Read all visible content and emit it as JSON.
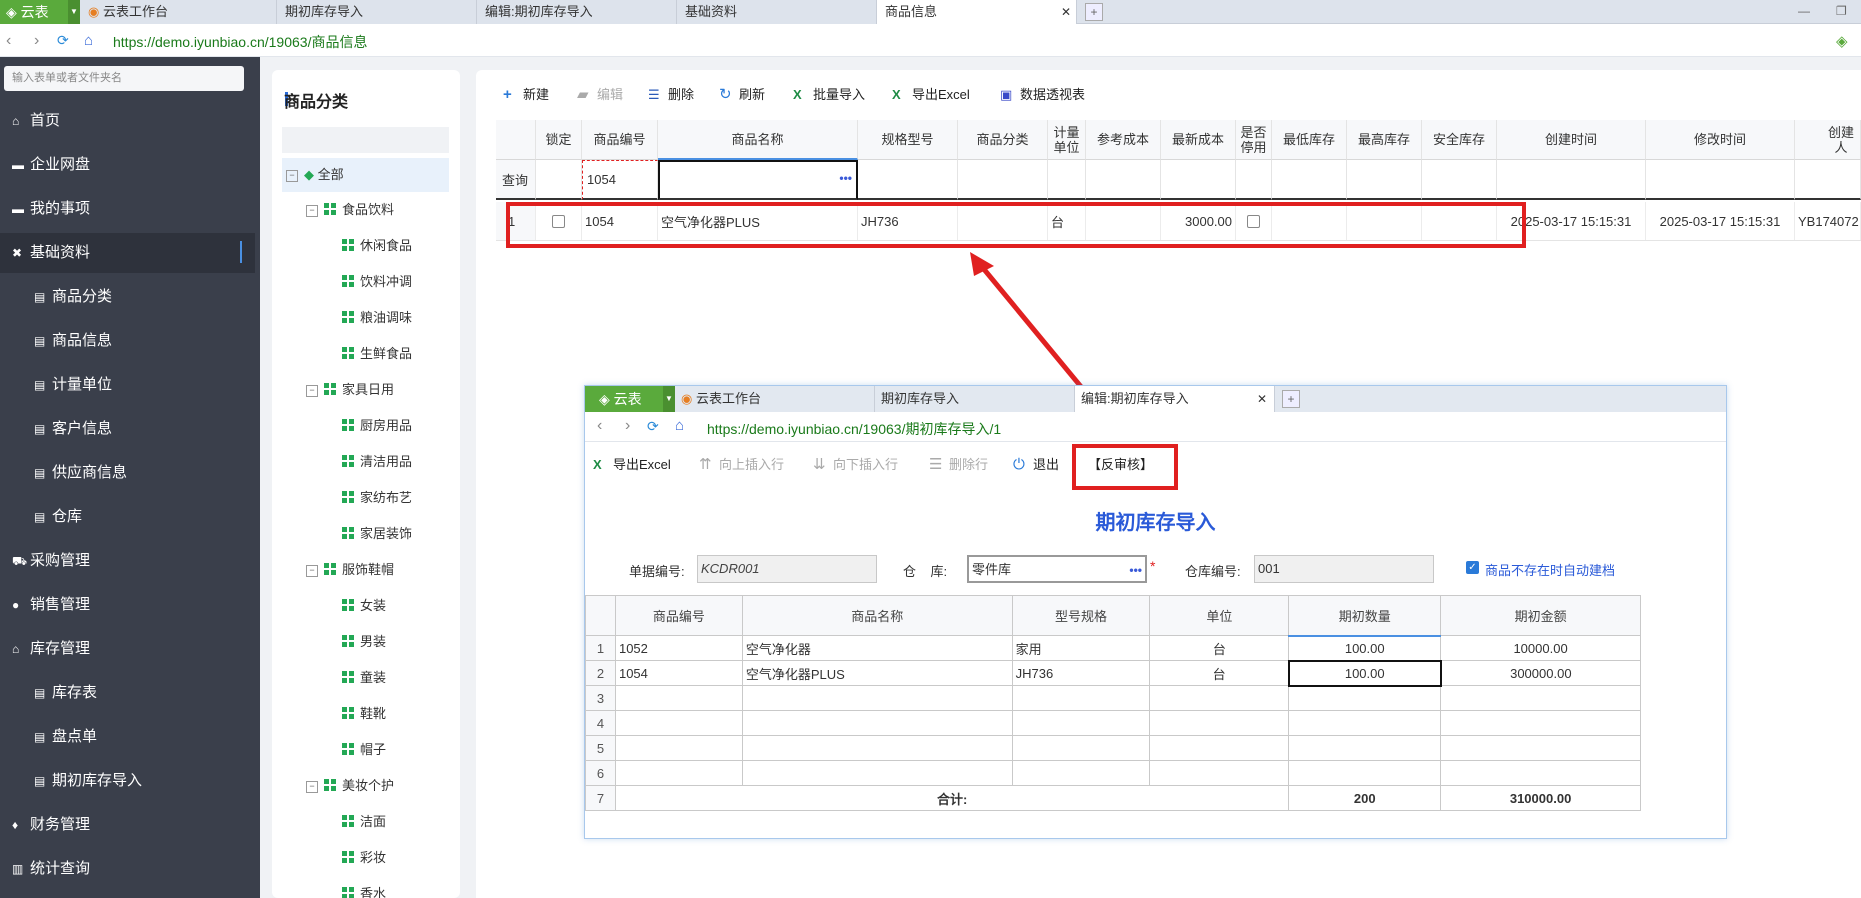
{
  "app": {
    "logo": "云表",
    "tabs": [
      {
        "label": "云表工作台"
      },
      {
        "label": "期初库存导入"
      },
      {
        "label": "编辑:期初库存导入"
      },
      {
        "label": "基础资料"
      },
      {
        "label": "商品信息"
      }
    ],
    "url": "https://demo.iyunbiao.cn/19063/商品信息"
  },
  "sidebar": {
    "search_placeholder": "输入表单或者文件夹名",
    "items": [
      {
        "label": "首页",
        "icon": "home-icon"
      },
      {
        "label": "企业网盘",
        "icon": "folder-icon"
      },
      {
        "label": "我的事项",
        "icon": "folder-icon"
      },
      {
        "label": "基础资料",
        "icon": "tools-icon"
      },
      {
        "label": "商品分类",
        "icon": "doc-icon"
      },
      {
        "label": "商品信息",
        "icon": "doc-icon"
      },
      {
        "label": "计量单位",
        "icon": "doc-icon"
      },
      {
        "label": "客户信息",
        "icon": "doc-icon"
      },
      {
        "label": "供应商信息",
        "icon": "doc-icon"
      },
      {
        "label": "仓库",
        "icon": "doc-icon"
      },
      {
        "label": "采购管理",
        "icon": "cart-icon"
      },
      {
        "label": "销售管理",
        "icon": "user-icon"
      },
      {
        "label": "库存管理",
        "icon": "home-icon"
      },
      {
        "label": "库存表",
        "icon": "doc-icon"
      },
      {
        "label": "盘点单",
        "icon": "doc-icon"
      },
      {
        "label": "期初库存导入",
        "icon": "doc-icon"
      },
      {
        "label": "财务管理",
        "icon": "money-icon"
      },
      {
        "label": "统计查询",
        "icon": "chart-icon"
      }
    ]
  },
  "category": {
    "title": "商品分类",
    "tree": [
      {
        "label": "全部",
        "level": 0
      },
      {
        "label": "食品饮料",
        "level": 1
      },
      {
        "label": "休闲食品",
        "level": 2
      },
      {
        "label": "饮料冲调",
        "level": 2
      },
      {
        "label": "粮油调味",
        "level": 2
      },
      {
        "label": "生鲜食品",
        "level": 2
      },
      {
        "label": "家具日用",
        "level": 1
      },
      {
        "label": "厨房用品",
        "level": 2
      },
      {
        "label": "清洁用品",
        "level": 2
      },
      {
        "label": "家纺布艺",
        "level": 2
      },
      {
        "label": "家居装饰",
        "level": 2
      },
      {
        "label": "服饰鞋帽",
        "level": 1
      },
      {
        "label": "女装",
        "level": 2
      },
      {
        "label": "男装",
        "level": 2
      },
      {
        "label": "童装",
        "level": 2
      },
      {
        "label": "鞋靴",
        "level": 2
      },
      {
        "label": "帽子",
        "level": 2
      },
      {
        "label": "美妆个护",
        "level": 1
      },
      {
        "label": "洁面",
        "level": 2
      },
      {
        "label": "彩妆",
        "level": 2
      },
      {
        "label": "香水",
        "level": 2
      }
    ]
  },
  "toolbar": {
    "new": "新建",
    "edit": "编辑",
    "delete": "删除",
    "refresh": "刷新",
    "batch_import": "批量导入",
    "export_excel": "导出Excel",
    "pivot": "数据透视表"
  },
  "grid": {
    "headers": [
      "锁定",
      "商品编号",
      "商品名称",
      "规格型号",
      "商品分类",
      "计量单位",
      "参考成本",
      "最新成本",
      "是否停用",
      "最低库存",
      "最高库存",
      "安全库存",
      "创建时间",
      "修改时间",
      "创建人"
    ],
    "query_label": "查询",
    "query_code": "1054",
    "row": {
      "index": "1",
      "code": "1054",
      "name": "空气净化器PLUS",
      "spec": "JH736",
      "unit": "台",
      "latest_cost": "3000.00",
      "created": "2025-03-17 15:15:31",
      "modified": "2025-03-17 15:15:31",
      "creator": "YB174072"
    }
  },
  "popup": {
    "logo": "云表",
    "tabs": [
      {
        "label": "云表工作台"
      },
      {
        "label": "期初库存导入"
      },
      {
        "label": "编辑:期初库存导入"
      }
    ],
    "url": "https://demo.iyunbiao.cn/19063/期初库存导入/1",
    "toolbar": {
      "export_excel": "导出Excel",
      "insert_above": "向上插入行",
      "insert_below": "向下插入行",
      "delete_row": "删除行",
      "exit": "退出",
      "unaudit": "【反审核】"
    },
    "form_title": "期初库存导入",
    "doc_no_label": "单据编号:",
    "doc_no": "KCDR001",
    "warehouse_label": "仓    库:",
    "warehouse": "零件库",
    "warehouse_code_label": "仓库编号:",
    "warehouse_code": "001",
    "auto_create_label": "商品不存在时自动建档",
    "table": {
      "headers": [
        "商品编号",
        "商品名称",
        "型号规格",
        "单位",
        "期初数量",
        "期初金额"
      ],
      "rows": [
        {
          "n": "1",
          "code": "1052",
          "name": "空气净化器",
          "spec": "家用",
          "unit": "台",
          "qty": "100.00",
          "amount": "10000.00"
        },
        {
          "n": "2",
          "code": "1054",
          "name": "空气净化器PLUS",
          "spec": "JH736",
          "unit": "台",
          "qty": "100.00",
          "amount": "300000.00"
        },
        {
          "n": "3",
          "code": "",
          "name": "",
          "spec": "",
          "unit": "",
          "qty": "",
          "amount": ""
        },
        {
          "n": "4",
          "code": "",
          "name": "",
          "spec": "",
          "unit": "",
          "qty": "",
          "amount": ""
        },
        {
          "n": "5",
          "code": "",
          "name": "",
          "spec": "",
          "unit": "",
          "qty": "",
          "amount": ""
        },
        {
          "n": "6",
          "code": "",
          "name": "",
          "spec": "",
          "unit": "",
          "qty": "",
          "amount": ""
        }
      ],
      "total_n": "7",
      "total_label": "合计:",
      "total_qty": "200",
      "total_amount": "310000.00"
    }
  },
  "colors": {
    "sidebar_bg": "#3a3f4b",
    "accent": "#2a6bd8",
    "highlight": "#e02020",
    "brand": "#5aaa3c"
  }
}
